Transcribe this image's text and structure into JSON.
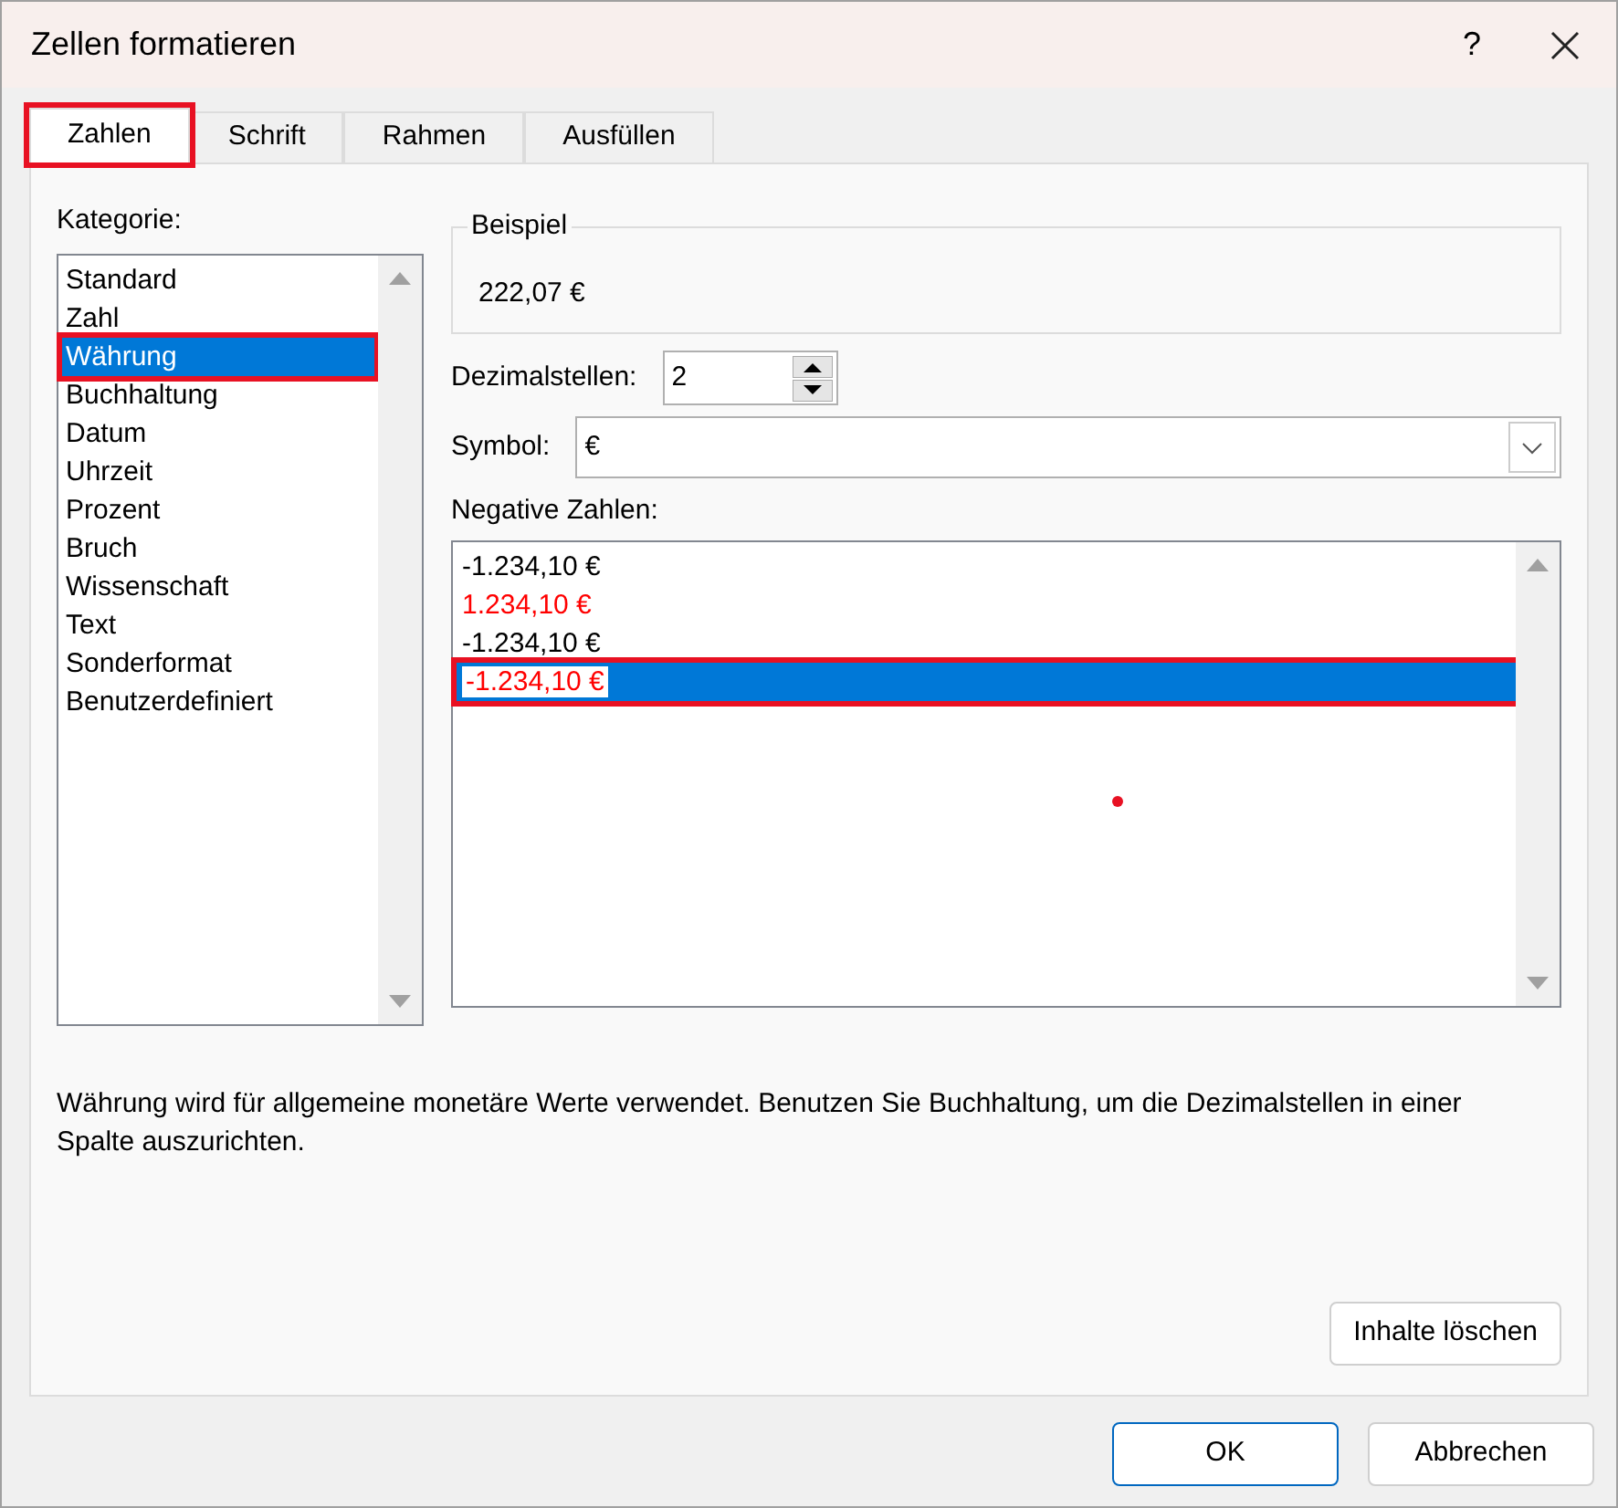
{
  "window": {
    "title": "Zellen formatieren",
    "help": "?"
  },
  "tabs": [
    {
      "label": "Zahlen",
      "selected": true,
      "highlighted": true
    },
    {
      "label": "Schrift",
      "selected": false,
      "highlighted": false
    },
    {
      "label": "Rahmen",
      "selected": false,
      "highlighted": false
    },
    {
      "label": "Ausfüllen",
      "selected": false,
      "highlighted": false
    }
  ],
  "category": {
    "label": "Kategorie:",
    "items": [
      {
        "label": "Standard",
        "selected": false,
        "highlighted": false
      },
      {
        "label": "Zahl",
        "selected": false,
        "highlighted": false
      },
      {
        "label": "Währung",
        "selected": true,
        "highlighted": true
      },
      {
        "label": "Buchhaltung",
        "selected": false,
        "highlighted": false
      },
      {
        "label": "Datum",
        "selected": false,
        "highlighted": false
      },
      {
        "label": "Uhrzeit",
        "selected": false,
        "highlighted": false
      },
      {
        "label": "Prozent",
        "selected": false,
        "highlighted": false
      },
      {
        "label": "Bruch",
        "selected": false,
        "highlighted": false
      },
      {
        "label": "Wissenschaft",
        "selected": false,
        "highlighted": false
      },
      {
        "label": "Text",
        "selected": false,
        "highlighted": false
      },
      {
        "label": "Sonderformat",
        "selected": false,
        "highlighted": false
      },
      {
        "label": "Benutzerdefiniert",
        "selected": false,
        "highlighted": false
      }
    ]
  },
  "sample": {
    "label": "Beispiel",
    "value": "222,07 €"
  },
  "decimals": {
    "label": "Dezimalstellen:",
    "value": "2"
  },
  "symbol": {
    "label": "Symbol:",
    "value": "€"
  },
  "negative": {
    "label": "Negative Zahlen:",
    "items": [
      {
        "label": "-1.234,10 €",
        "color": "#000000",
        "selected": false,
        "highlighted": false
      },
      {
        "label": "1.234,10 €",
        "color": "#ff0000",
        "selected": false,
        "highlighted": false
      },
      {
        "label": "-1.234,10 €",
        "color": "#000000",
        "selected": false,
        "highlighted": false
      },
      {
        "label": "-1.234,10 €",
        "color": "#ff0000",
        "selected": true,
        "highlighted": true
      }
    ]
  },
  "description": "Währung wird für allgemeine monetäre Werte verwendet. Benutzen Sie Buchhaltung, um die Dezimalstellen in einer Spalte auszurichten.",
  "clear_button": "Inhalte löschen",
  "buttons": [
    {
      "label": "OK",
      "kind": "primary"
    },
    {
      "label": "Abbrechen",
      "kind": "secondary"
    }
  ]
}
